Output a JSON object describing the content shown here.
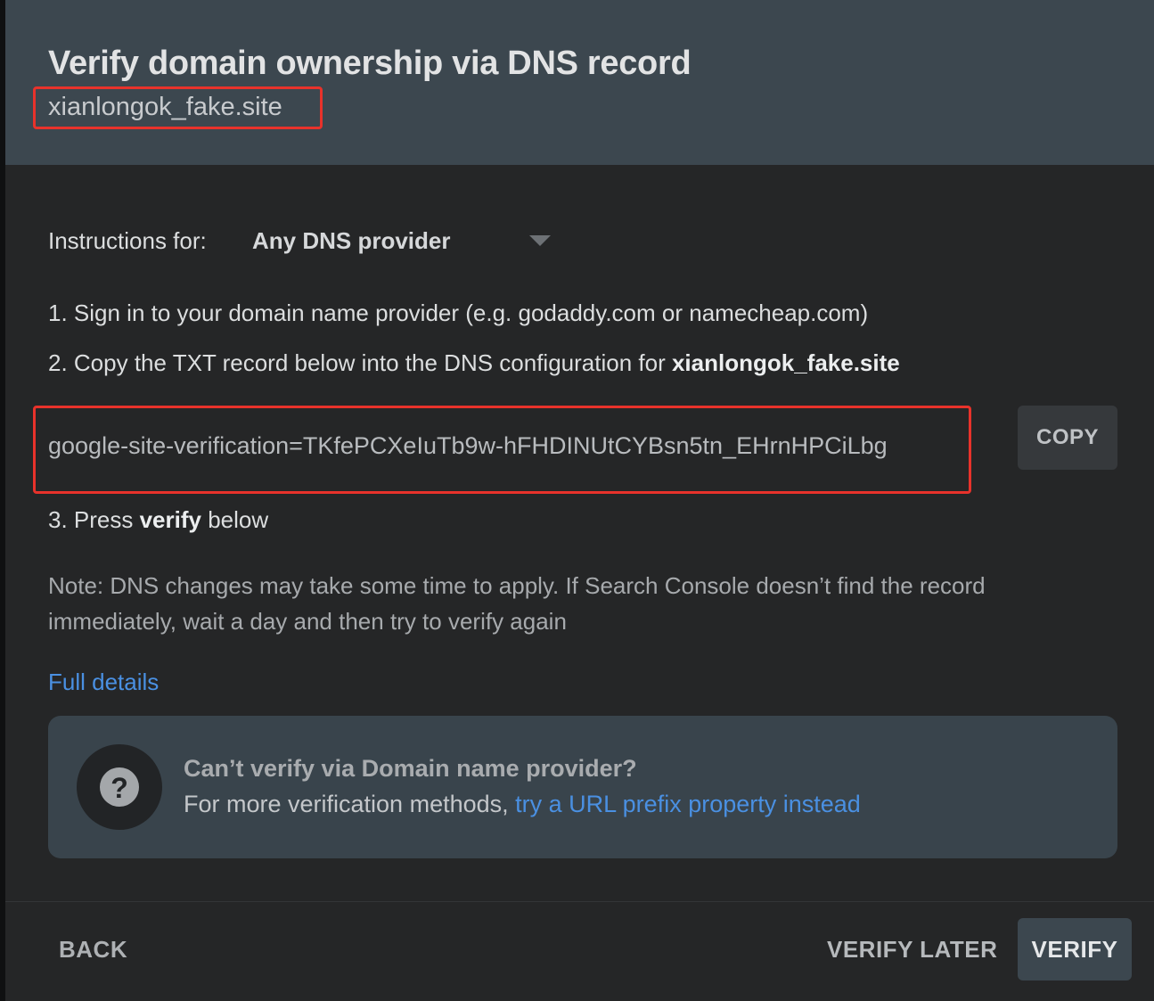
{
  "dialog": {
    "title": "Verify domain ownership via DNS record",
    "domain": "xianlongok_fake.site"
  },
  "instructions": {
    "label": "Instructions for:",
    "provider_selected": "Any DNS provider",
    "step1": "1. Sign in to your domain name provider (e.g. godaddy.com or namecheap.com)",
    "step2_prefix": "2. Copy the TXT record below into the DNS configuration for ",
    "step2_domain": "xianlongok_fake.site",
    "txt_record": "google-site-verification=TKfePCXeIuTb9w-hFHDINUtCYBsn5tn_EHrnHPCiLbg",
    "copy_label": "COPY",
    "step3_prefix": "3. Press ",
    "step3_bold": "verify",
    "step3_suffix": " below",
    "note": "Note: DNS changes may take some time to apply. If Search Console doesn’t find the record immediately, wait a day and then try to verify again",
    "full_details": "Full details"
  },
  "alternative": {
    "icon": "help-icon",
    "icon_glyph": "?",
    "title": "Can’t verify via Domain name provider?",
    "text_prefix": "For more verification methods, ",
    "link": "try a URL prefix property instead"
  },
  "footer": {
    "back": "BACK",
    "verify_later": "VERIFY LATER",
    "verify": "VERIFY"
  },
  "colors": {
    "header_bg": "#3c474f",
    "dialog_bg": "#252627",
    "link": "#4a90e2",
    "highlight_box": "#e8322b"
  }
}
